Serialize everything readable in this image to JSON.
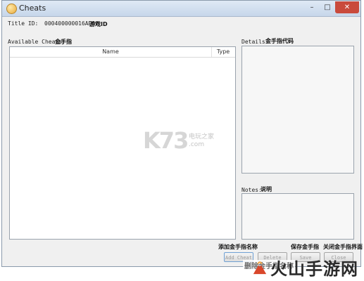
{
  "window": {
    "title": "Cheats",
    "min_glyph": "–",
    "max_glyph": "□",
    "close_glyph": "✕"
  },
  "title_id": {
    "label": "Title ID:",
    "value": "000400000016AD00",
    "annotation": "游戏ID"
  },
  "available_cheats": {
    "label": "Available Cheats:",
    "annotation": "金手指",
    "columns": [
      "Name",
      "Type"
    ]
  },
  "details": {
    "label": "Details:",
    "annotation": "金手指代码"
  },
  "notes": {
    "label": "Notes:",
    "annotation": "说明"
  },
  "buttons": {
    "add": {
      "label": "Add Cheat",
      "annotation": "添加金手指名称"
    },
    "delete": {
      "label": "Delete"
    },
    "save": {
      "label": "Save",
      "annotation": "保存金手指"
    },
    "close": {
      "label": "Close",
      "annotation": "关闭金手指界面"
    }
  },
  "overlay": {
    "k73_logo": "K73",
    "k73_site": "电玩之家",
    "k73_url": ".com",
    "bottom_caption": "删除金手指名称",
    "brand": "火山手游网"
  }
}
